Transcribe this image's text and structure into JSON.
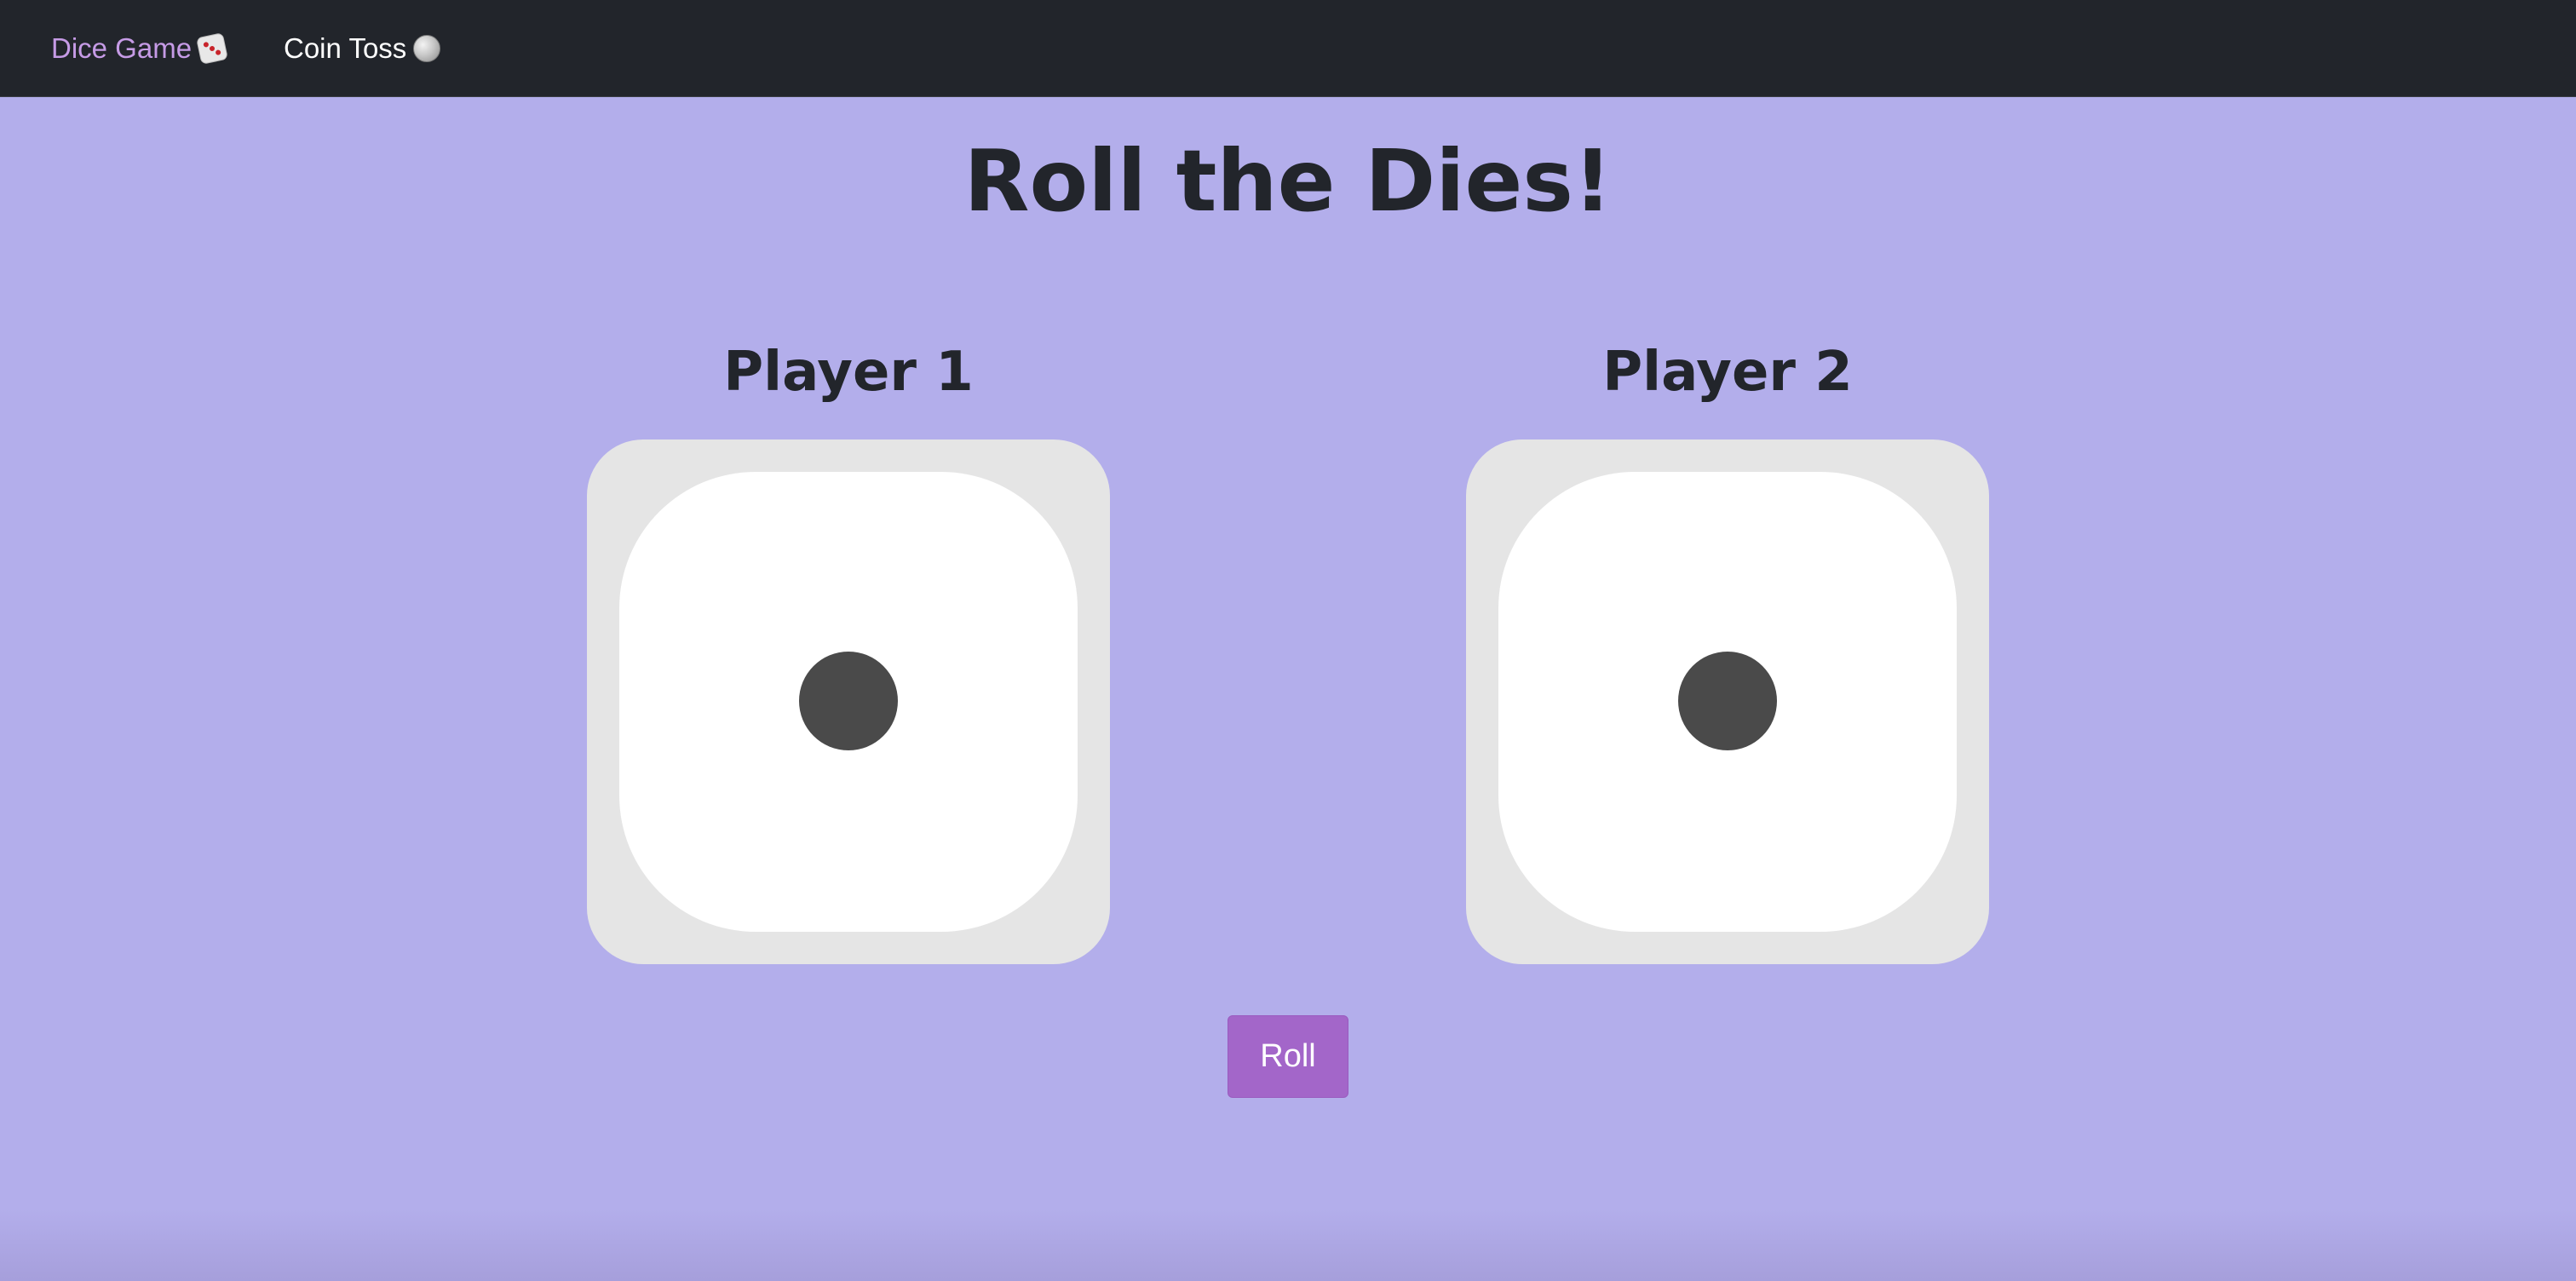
{
  "nav": {
    "items": [
      {
        "label": "Dice Game",
        "icon": "die-icon",
        "active": true
      },
      {
        "label": "Coin Toss",
        "icon": "coin-icon",
        "active": false
      }
    ]
  },
  "main": {
    "title": "Roll the Dies!",
    "players": [
      {
        "name": "Player 1",
        "die_value": 1
      },
      {
        "name": "Player 2",
        "die_value": 1
      }
    ],
    "roll_label": "Roll"
  },
  "colors": {
    "background": "#b3aeeb",
    "navbar": "#22252b",
    "active_link": "#c69be6",
    "button": "#a366c9",
    "die_frame": "#e5e5e5",
    "pip": "#4a4a4a"
  }
}
